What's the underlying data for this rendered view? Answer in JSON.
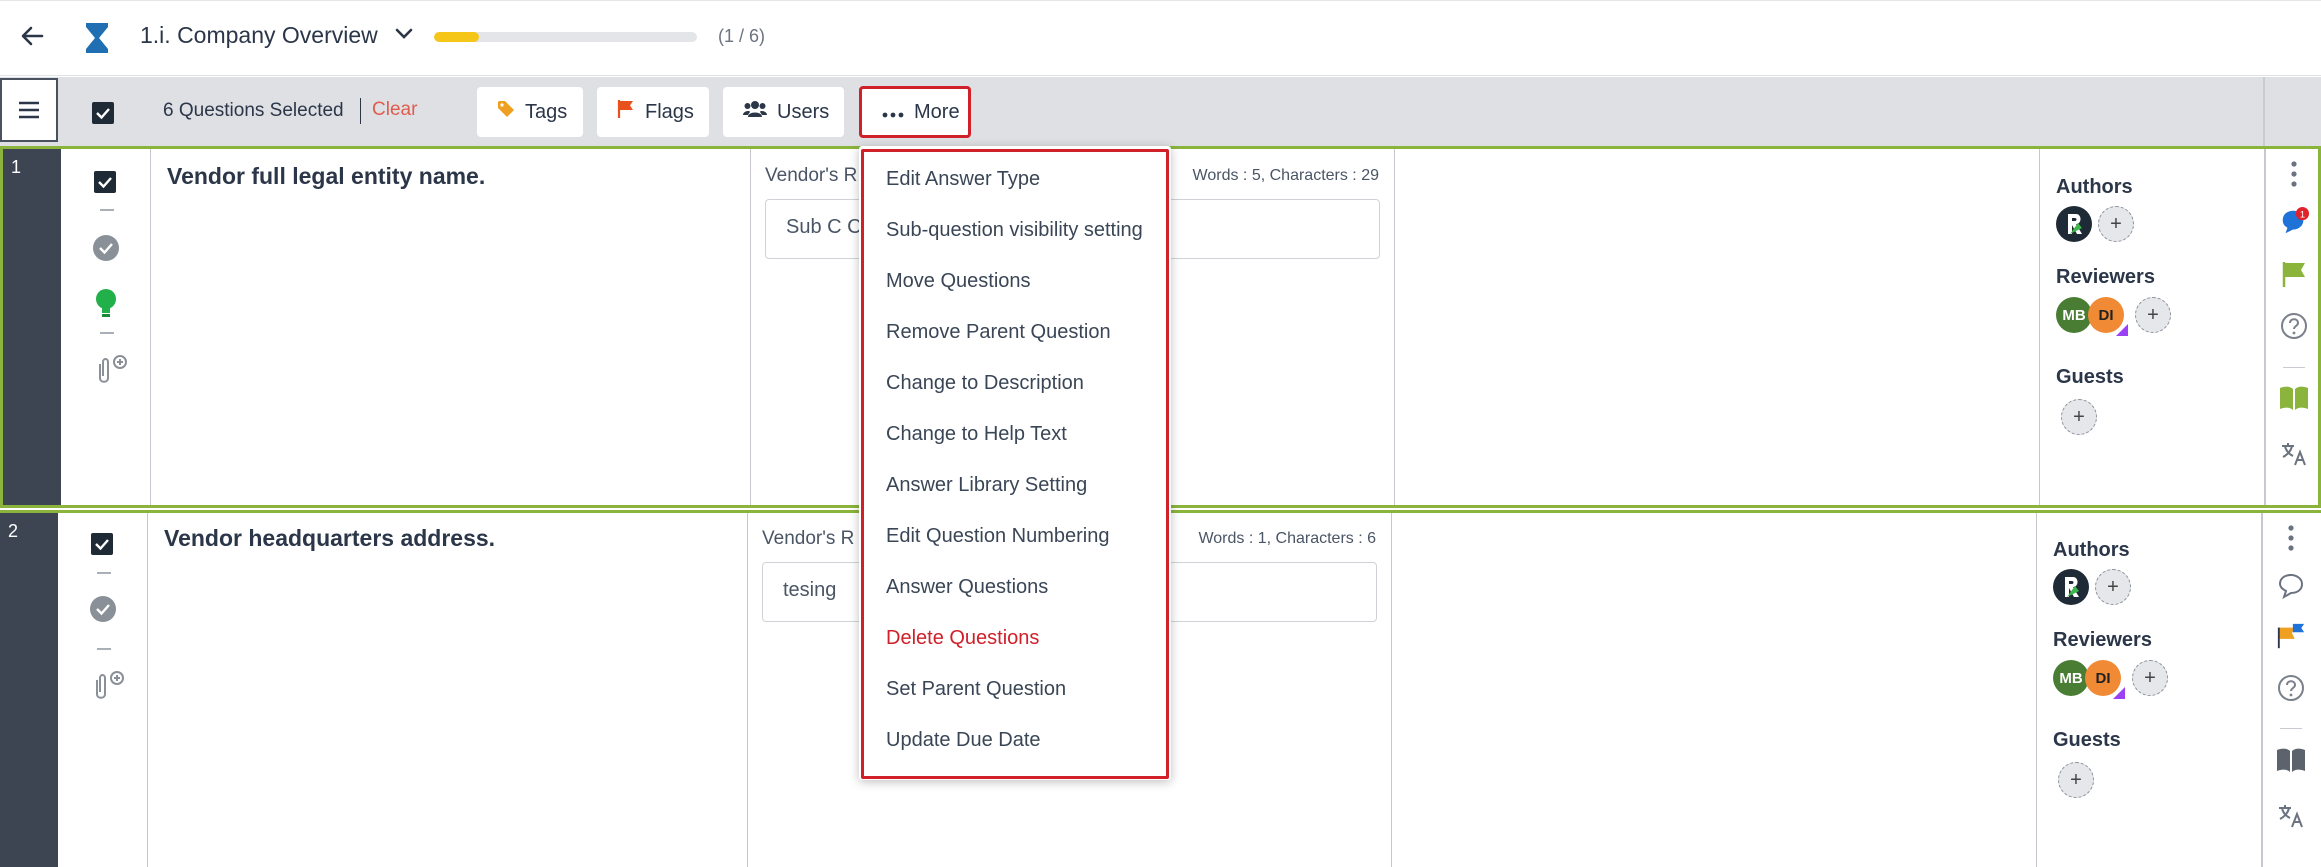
{
  "header": {
    "title": "1.i. Company Overview",
    "progress_fraction": 0.17,
    "progress_text": "(1 / 6)"
  },
  "toolbar": {
    "selected_text": "6 Questions Selected",
    "clear_label": "Clear",
    "tags_label": "Tags",
    "flags_label": "Flags",
    "users_label": "Users",
    "more_label": "More"
  },
  "dropdown": {
    "items": [
      "Edit Answer Type",
      "Sub-question visibility setting",
      "Move Questions",
      "Remove Parent Question",
      "Change to Description",
      "Change to Help Text",
      "Answer Library Setting",
      "Edit Question Numbering",
      "Answer Questions",
      "Delete Questions",
      "Set Parent Question",
      "Update Due Date"
    ]
  },
  "questions": [
    {
      "number": "1",
      "text": "Vendor full legal entity name.",
      "response_label": "Vendor's R",
      "word_count": "Words : 5, Characters : 29",
      "answer": "Sub C Co",
      "comment_badge": "1"
    },
    {
      "number": "2",
      "text": "Vendor headquarters address.",
      "response_label": "Vendor's R",
      "word_count": "Words : 1, Characters : 6",
      "answer": "tesing"
    }
  ],
  "people": {
    "authors_label": "Authors",
    "reviewers_label": "Reviewers",
    "guests_label": "Guests",
    "reviewer1": "MB",
    "reviewer2": "DI",
    "add": "+"
  },
  "colors": {
    "accent_green": "#8ab43c",
    "danger_red": "#d0202a",
    "progress_yellow": "#f5c518"
  }
}
